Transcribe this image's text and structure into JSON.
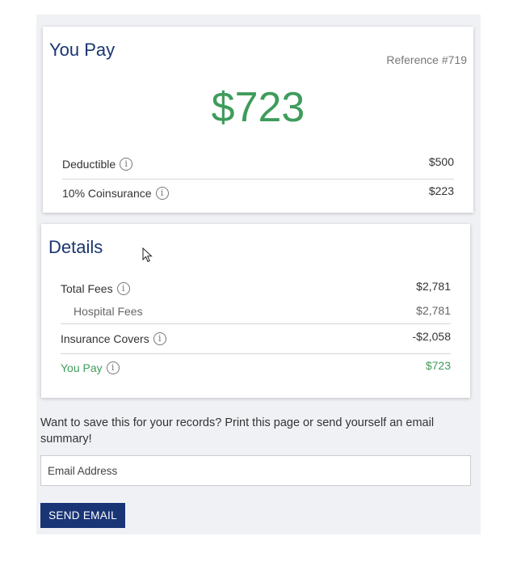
{
  "you_pay_card": {
    "title": "You Pay",
    "reference": "Reference #719",
    "total": "$723",
    "rows": [
      {
        "label": "Deductible",
        "amount": "$500"
      },
      {
        "label": "10% Coinsurance",
        "amount": "$223"
      }
    ]
  },
  "details_card": {
    "title": "Details",
    "rows": [
      {
        "label": "Total Fees",
        "amount": "$2,781"
      },
      {
        "label": "Hospital Fees",
        "amount": "$2,781"
      },
      {
        "label": "Insurance Covers",
        "amount": "-$2,058"
      },
      {
        "label": "You Pay",
        "amount": "$723"
      }
    ]
  },
  "save": {
    "text": "Want to save this for your records? Print this page or send yourself an email summary!",
    "email_placeholder": "Email Address",
    "button_label": "SEND EMAIL"
  },
  "icons": {
    "info": "info-icon",
    "cursor": "mouse-pointer-icon"
  },
  "colors": {
    "accent_green": "#3f9c5b",
    "title_navy": "#1a3570",
    "button_navy": "#1a3576"
  }
}
